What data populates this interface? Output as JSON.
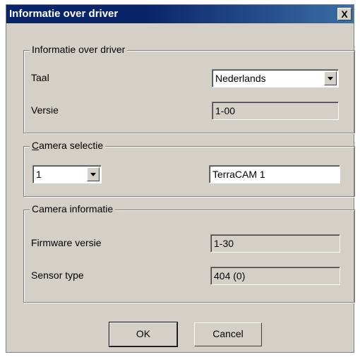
{
  "window": {
    "title": "Informatie over driver",
    "close_label": "X"
  },
  "driver_group": {
    "legend": "Informatie over driver",
    "taal_label": "Taal",
    "taal_value": "Nederlands",
    "versie_label": "Versie",
    "versie_value": "1-00"
  },
  "camera_select": {
    "legend_first_letter": "C",
    "legend_rest": "amera selectie",
    "camera_index": "1",
    "camera_name": "TerraCAM 1"
  },
  "camera_info": {
    "legend": "Camera informatie",
    "firmware_label": "Firmware versie",
    "firmware_value": "1-30",
    "sensor_label": "Sensor type",
    "sensor_value": "404 (0)"
  },
  "buttons": {
    "ok": "OK",
    "cancel": "Cancel"
  }
}
